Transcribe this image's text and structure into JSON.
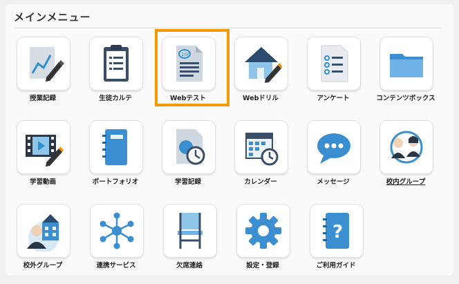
{
  "section_title": "メインメニュー",
  "selected_index": 2,
  "accent_color": "#f29a00",
  "items": [
    {
      "label": "授業記録",
      "icon": "chart-pen-icon",
      "underline": false
    },
    {
      "label": "生徒カルテ",
      "icon": "clipboard-icon",
      "underline": false
    },
    {
      "label": "Webテスト",
      "icon": "test-paper-icon",
      "underline": false
    },
    {
      "label": "Webドリル",
      "icon": "house-pen-icon",
      "underline": false
    },
    {
      "label": "アンケート",
      "icon": "checklist-icon",
      "underline": false
    },
    {
      "label": "コンテンツボックス",
      "icon": "folder-icon",
      "underline": false
    },
    {
      "label": "学習動画",
      "icon": "video-pen-icon",
      "underline": false
    },
    {
      "label": "ポートフォリオ",
      "icon": "binder-icon",
      "underline": false
    },
    {
      "label": "学習記録",
      "icon": "record-clock-icon",
      "underline": false
    },
    {
      "label": "カレンダー",
      "icon": "calendar-clock-icon",
      "underline": false
    },
    {
      "label": "メッセージ",
      "icon": "chat-bubble-icon",
      "underline": false
    },
    {
      "label": "校内グループ",
      "icon": "group-people-icon",
      "underline": true
    },
    {
      "label": "校外グループ",
      "icon": "school-person-icon",
      "underline": false
    },
    {
      "label": "連携サービス",
      "icon": "network-icon",
      "underline": false
    },
    {
      "label": "欠席連絡",
      "icon": "chair-icon",
      "underline": false
    },
    {
      "label": "設定・登録",
      "icon": "gear-icon",
      "underline": false
    },
    {
      "label": "ご利用ガイド",
      "icon": "guide-icon",
      "underline": false
    }
  ]
}
